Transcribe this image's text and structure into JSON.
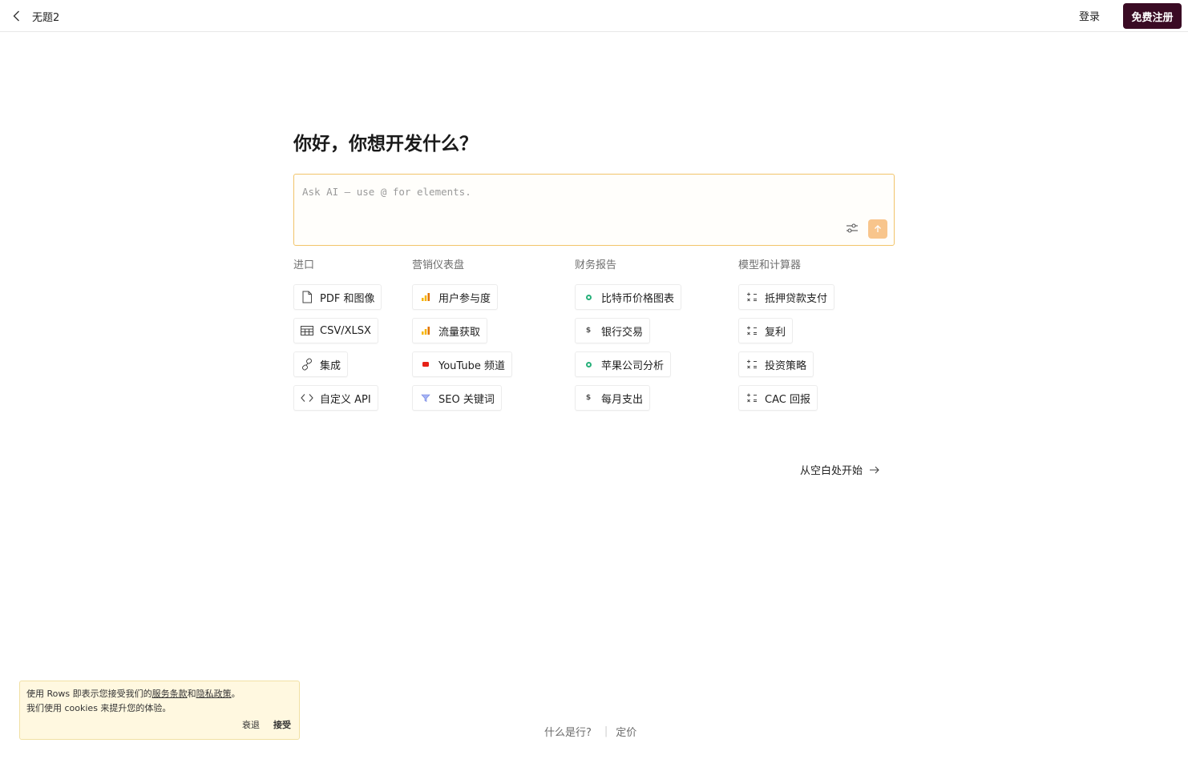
{
  "header": {
    "doc_title": "无题2",
    "login_label": "登录",
    "signup_label": "免费注册"
  },
  "main": {
    "heading": "你好，你想开发什么？",
    "prompt_placeholder": "Ask AI — use @ for elements."
  },
  "categories": [
    {
      "title": "进口",
      "items": [
        {
          "label": "PDF 和图像",
          "icon": "file-icon"
        },
        {
          "label": "CSV/XLSX",
          "icon": "table-icon"
        },
        {
          "label": "集成",
          "icon": "link-icon"
        },
        {
          "label": "自定义 API",
          "icon": "code-icon"
        }
      ]
    },
    {
      "title": "营销仪表盘",
      "items": [
        {
          "label": "用户参与度",
          "icon": "analytics-icon"
        },
        {
          "label": "流量获取",
          "icon": "analytics-icon"
        },
        {
          "label": "YouTube 频道",
          "icon": "youtube-icon"
        },
        {
          "label": "SEO 关键词",
          "icon": "seo-icon"
        }
      ]
    },
    {
      "title": "财务报告",
      "items": [
        {
          "label": "比特币价格图表",
          "icon": "circle-icon"
        },
        {
          "label": "银行交易",
          "icon": "dollar-icon"
        },
        {
          "label": "苹果公司分析",
          "icon": "circle-icon"
        },
        {
          "label": "每月支出",
          "icon": "dollar-icon"
        }
      ]
    },
    {
      "title": "模型和计算器",
      "items": [
        {
          "label": "抵押贷款支付",
          "icon": "calculator-icon"
        },
        {
          "label": "复利",
          "icon": "calculator-icon"
        },
        {
          "label": "投资策略",
          "icon": "calculator-icon"
        },
        {
          "label": "CAC 回报",
          "icon": "calculator-icon"
        }
      ]
    }
  ],
  "blank_start_label": "从空白处开始",
  "cookie": {
    "line1_prefix": "使用 Rows 即表示您接受我们的",
    "terms_link": "服务条款",
    "and": "和",
    "privacy_link": "隐私政策",
    "line1_suffix": "。",
    "line2": "我们使用 cookies 来提升您的体验。",
    "decline_label": "衰退",
    "accept_label": "接受"
  },
  "footer": {
    "what_label": "什么是行?",
    "pricing_label": "定价"
  },
  "colors": {
    "brand": "#3a0b24",
    "prompt_border": "#f2c46a",
    "send_button": "#f8c58c",
    "cookie_bg": "#fff8e0"
  }
}
